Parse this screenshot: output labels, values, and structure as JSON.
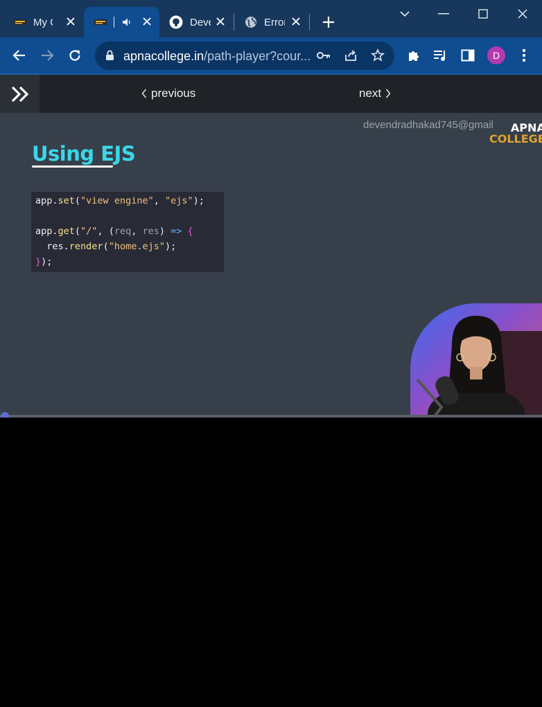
{
  "browser": {
    "tabs": [
      {
        "title": "My C",
        "favicon": "apna-college-favicon"
      },
      {
        "title": "",
        "favicon": "apna-college-favicon",
        "audio": "speaker-icon"
      },
      {
        "title": "Deve",
        "favicon": "github-icon"
      },
      {
        "title": "Error",
        "favicon": "globe-icon"
      }
    ],
    "address_bar": {
      "domain": "apnacollege.in",
      "path": "/path-player?cour..."
    },
    "profile_initial": "D",
    "colors": {
      "frame": "#17375c",
      "toolbar": "#0f4c90",
      "profile": "#b43ab0"
    }
  },
  "course_nav": {
    "previous_label": "previous",
    "next_label": "next"
  },
  "video": {
    "watermark_email": "devendradhakad745@gmail",
    "brand_line1": "APNA",
    "brand_line2": "COLLEGE",
    "slide_title": "Using EJS",
    "code_lines": [
      "app.set(\"view engine\", \"ejs\");",
      "",
      "app.get(\"/\", (req, res) => {",
      "  res.render(\"home.ejs\");",
      "});"
    ],
    "progress_fraction": 0.0
  }
}
